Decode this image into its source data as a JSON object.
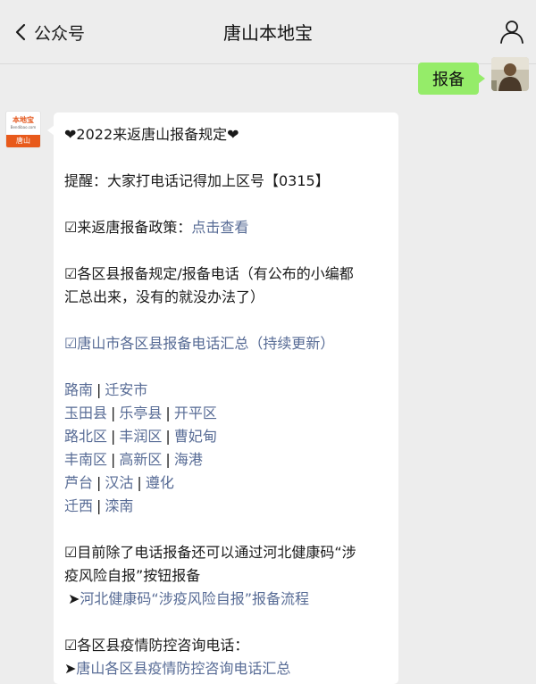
{
  "navbar": {
    "back_label": "公众号",
    "title": "唐山本地宝"
  },
  "outgoing": {
    "text": "报备"
  },
  "account": {
    "logo_main": "本地宝",
    "logo_sub": "Bendibao.com",
    "logo_city": "唐山"
  },
  "message": {
    "title": "❤2022来返唐山报备规定❤",
    "reminder": "提醒：大家打电话记得加上区号【0315】",
    "policy_prefix": "☑来返唐报备政策：",
    "policy_link": "点击查看",
    "rules_line1": "☑各区县报备规定/报备电话（有公布的小编都",
    "rules_line2": "汇总出来，没有的就没办法了）",
    "summary_link": "☑唐山市各区县报备电话汇总（持续更新）",
    "separator": "|",
    "district_rows": [
      [
        "路南",
        "迁安市"
      ],
      [
        "玉田县",
        "乐亭县",
        "开平区"
      ],
      [
        "路北区",
        "丰润区",
        "曹妃甸"
      ],
      [
        "丰南区",
        "高新区",
        "海港"
      ],
      [
        "芦台",
        "汉沽",
        "遵化"
      ],
      [
        "迁西",
        "滦南"
      ]
    ],
    "health_line1": "☑目前除了电话报备还可以通过河北健康码“涉",
    "health_line2": "疫风险自报”按钮报备",
    "health_arrow": "➤",
    "health_link": "河北健康码“涉疫风险自报”报备流程",
    "consult_line": "☑各区县疫情防控咨询电话：",
    "consult_arrow": "➤",
    "consult_link": "唐山各区县疫情防控咨询电话汇总"
  },
  "colors": {
    "link": "#576b95",
    "bubble_out": "#95ec69",
    "bubble_in": "#ffffff",
    "background": "#ededed",
    "logo_accent": "#e85a1b"
  }
}
